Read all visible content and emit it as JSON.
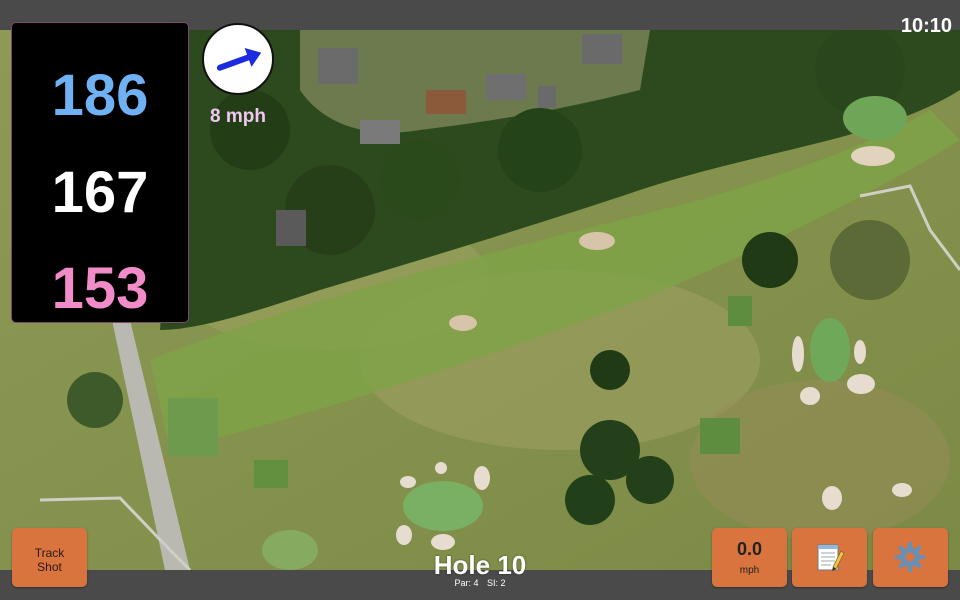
{
  "status": {
    "time": "10:10"
  },
  "distances": {
    "back": "186",
    "middle": "167",
    "front": "153",
    "colors": {
      "back": "#6fb1f2",
      "middle": "#ffffff",
      "front": "#f28cc8"
    }
  },
  "wind": {
    "speed_label": "8 mph",
    "icon": "wind-direction-arrow-icon",
    "arrow_color": "#1a2be0",
    "label_color": "#f0c8f0"
  },
  "hole": {
    "title": "Hole 10",
    "par_label": "Par: 4",
    "si_label": "SI: 2"
  },
  "buttons": {
    "track_shot": {
      "line1": "Track",
      "line2": "Shot"
    },
    "speed": {
      "value": "0.0",
      "unit": "mph"
    },
    "notes": {
      "icon": "notepad-icon"
    },
    "settings": {
      "icon": "gear-icon"
    },
    "color": "#d9743f"
  },
  "map": {
    "type": "satellite-aerial-golf-course"
  }
}
